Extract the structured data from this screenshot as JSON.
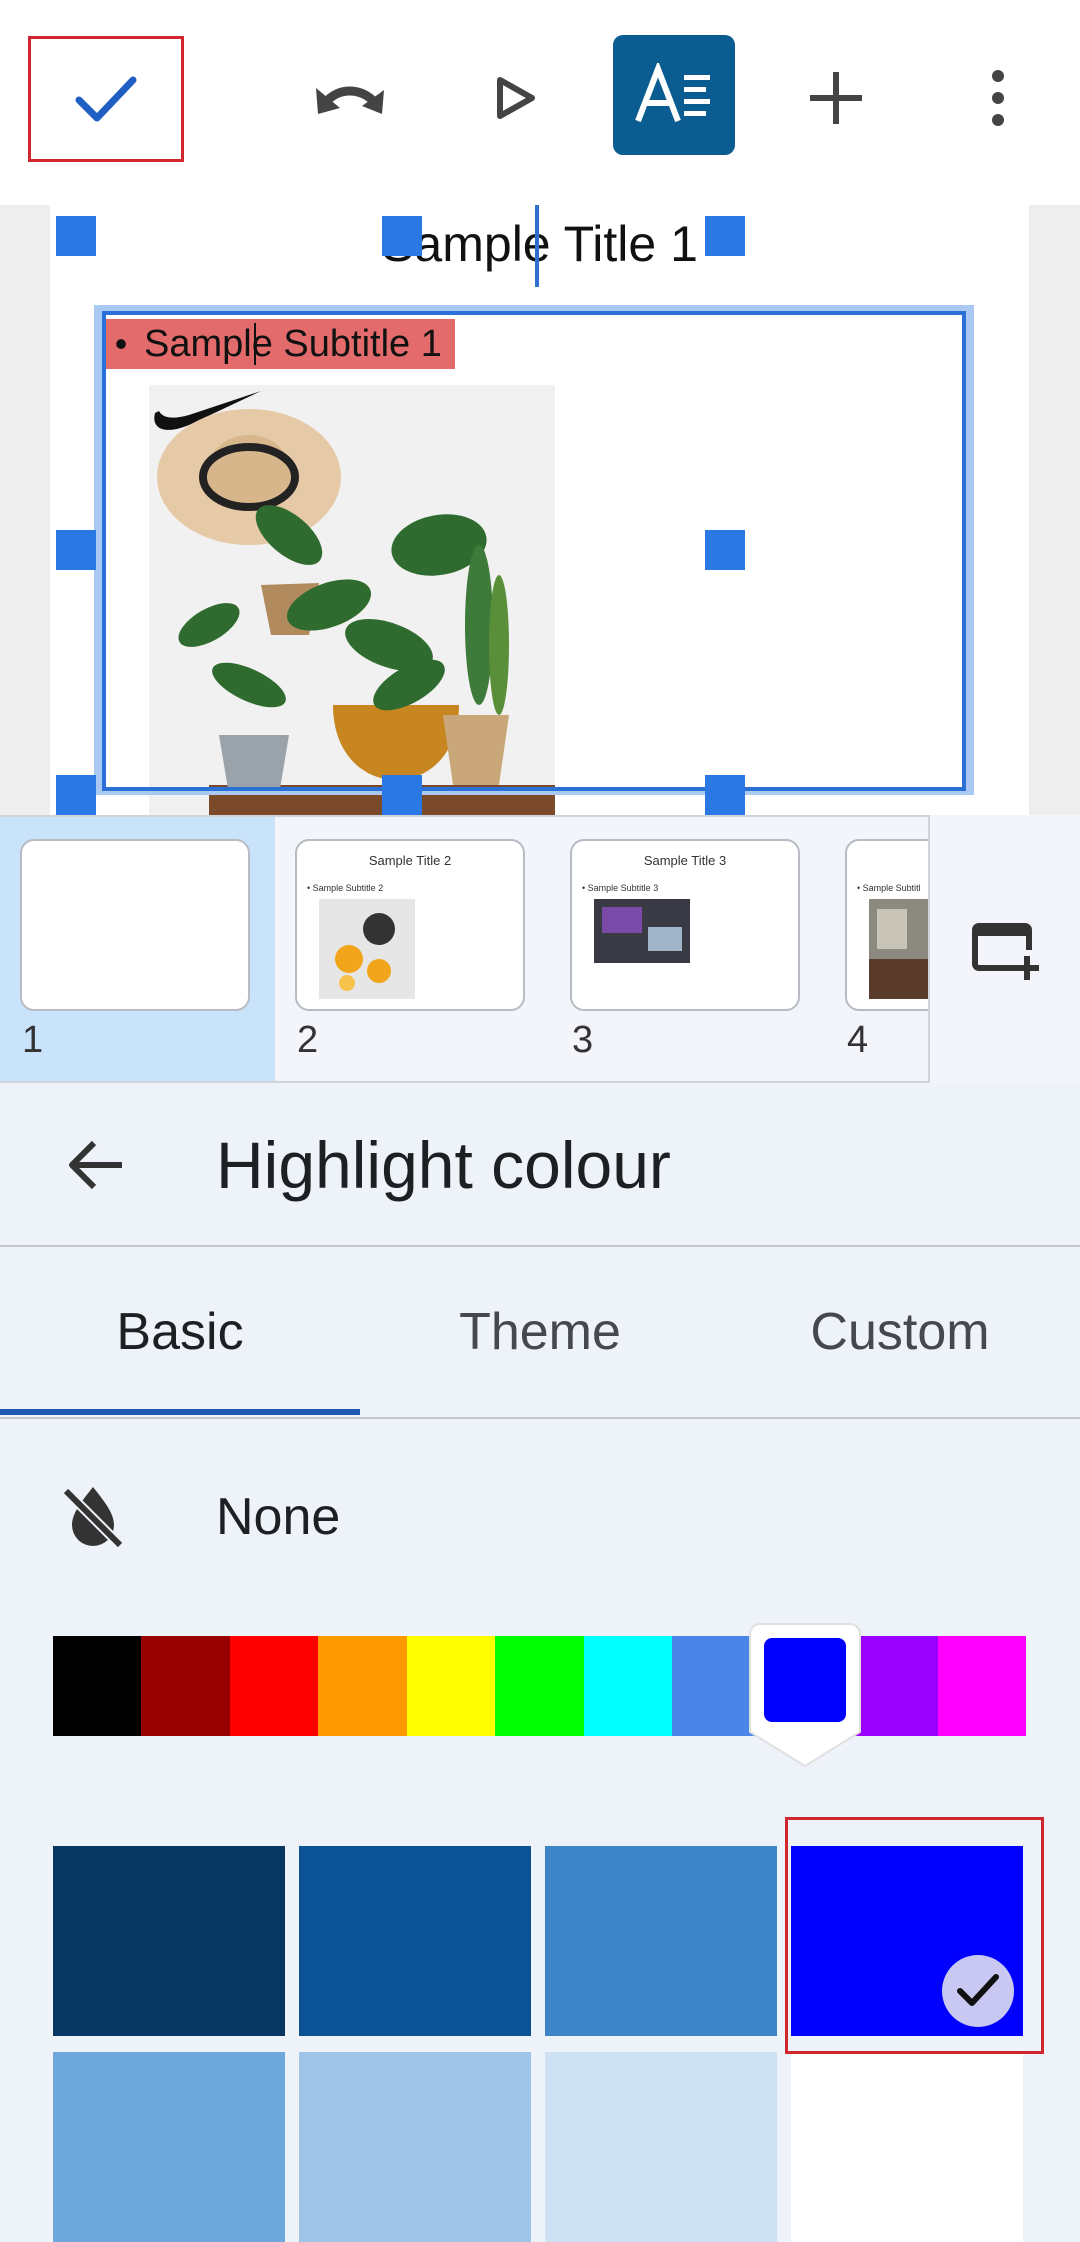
{
  "toolbar": {
    "done_icon": "check-icon",
    "undo_icon": "undo-icon",
    "play_icon": "play-icon",
    "format_icon": "text-format-icon",
    "add_icon": "plus-icon",
    "more_icon": "more-vert-icon",
    "accent": "#0b5c91"
  },
  "slide": {
    "title": "Sample Title 1",
    "subtitle": "Sample Subtitle 1",
    "subtitle_bullet": "•",
    "highlight_color": "#e36b6b"
  },
  "thumbnails": [
    {
      "number": "1",
      "title": "",
      "subtitle": "",
      "selected": true
    },
    {
      "number": "2",
      "title": "Sample Title 2",
      "subtitle": "Sample Subtitle 2",
      "selected": false
    },
    {
      "number": "3",
      "title": "Sample Title 3",
      "subtitle": "Sample Subtitle 3",
      "selected": false
    },
    {
      "number": "4",
      "title": "S",
      "subtitle": "Sample Subtitl",
      "selected": false
    }
  ],
  "panel": {
    "title": "Highlight colour",
    "back_icon": "arrow-back-icon",
    "tabs": [
      "Basic",
      "Theme",
      "Custom"
    ],
    "active_tab": "Basic",
    "none_label": "None",
    "none_icon": "format-color-reset-icon"
  },
  "hues": [
    "#000000",
    "#990000",
    "#ff0000",
    "#ff9900",
    "#ffff00",
    "#00ff00",
    "#00ffff",
    "#4a86e8",
    "#0000ff",
    "#9900ff",
    "#ff00ff"
  ],
  "selected_hue": "#0000ff",
  "swatches": [
    "#073763",
    "#0b5394",
    "#3d85c6",
    "#0000ff",
    "#6fa8dc",
    "#9fc5e8",
    "#cfe2f3",
    "#ffffff"
  ],
  "selected_swatch": "#0000ff"
}
